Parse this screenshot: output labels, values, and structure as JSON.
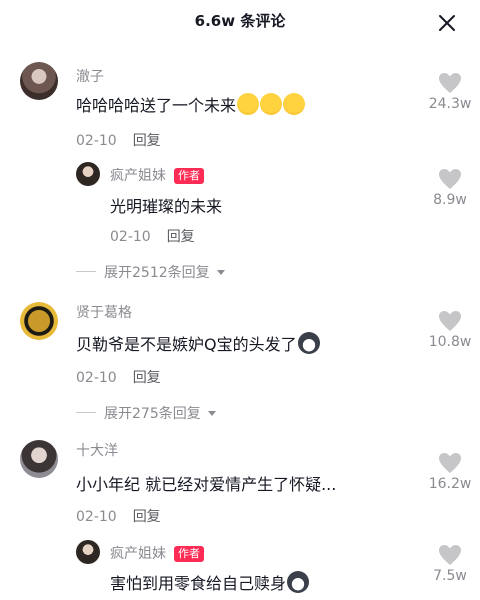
{
  "header": {
    "title": "6.6w 条评论"
  },
  "comments": [
    {
      "name": "澈子",
      "text": "哈哈哈哈送了一个未来",
      "date": "02-10",
      "reply": "回复",
      "likes": "24.3w"
    },
    {
      "name": "疯产姐妹",
      "badge": "作者",
      "text": "光明璀璨的未来",
      "date": "02-10",
      "reply": "回复",
      "likes": "8.9w"
    },
    {
      "expand": "展开2512条回复"
    },
    {
      "name": "贤于葛格",
      "text": "贝勒爷是不是嫉妒Q宝的头发了",
      "date": "02-10",
      "reply": "回复",
      "likes": "10.8w"
    },
    {
      "expand": "展开275条回复"
    },
    {
      "name": "十大洋",
      "text": "小小年纪 就已经对爱情产生了怀疑...",
      "date": "02-10",
      "reply": "回复",
      "likes": "16.2w"
    },
    {
      "name": "疯产姐妹",
      "badge": "作者",
      "text": "害怕到用零食给自己赎身",
      "likes": "7.5w"
    }
  ],
  "icons": {
    "close": "close-icon",
    "like": "heart-icon",
    "expand": "chevron-down-icon",
    "emoji_cry_laugh": "laugh-cry-emoji",
    "emoji_husky": "husky-emoji"
  },
  "colors": {
    "badge": "#fe2c55",
    "secondary_text": "#8a8b91",
    "icon_gray": "#c6c6c8"
  }
}
